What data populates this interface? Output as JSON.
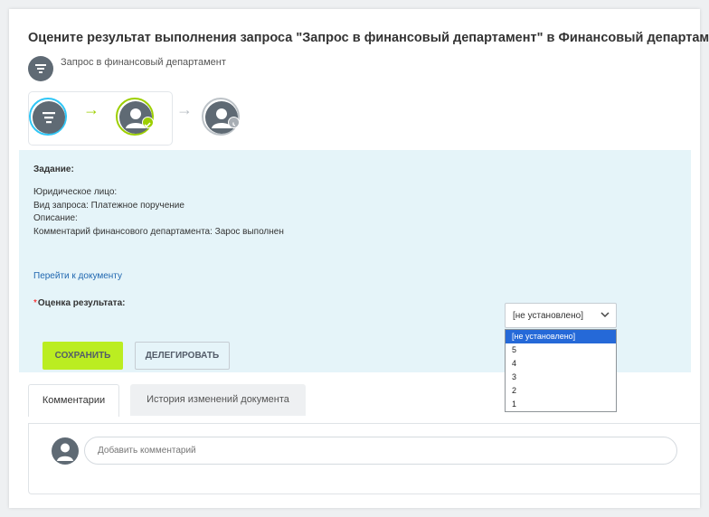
{
  "header": {
    "title": "Оцените результат выполнения запроса \"Запрос в финансовый департамент\" в Финансовый департамент!",
    "subtitle": "Запрос в финансовый департамент"
  },
  "task": {
    "heading": "Задание:",
    "lines": [
      "Юридическое лицо:",
      "Вид запроса: Платежное поручение",
      "Описание:",
      "Комментарий финансового департамента: Зарос выполнен"
    ],
    "doc_link": "Перейти к документу"
  },
  "rating": {
    "required_mark": "*",
    "label": "Оценка результата:",
    "selected": "[не установлено]",
    "options": [
      "[не установлено]",
      "5",
      "4",
      "3",
      "2",
      "1"
    ]
  },
  "buttons": {
    "save": "СОХРАНИТЬ",
    "delegate": "ДЕЛЕГИРОВАТЬ"
  },
  "tabs": [
    {
      "label": "Комментарии"
    },
    {
      "label": "История изменений документа"
    }
  ],
  "comment": {
    "placeholder": "Добавить комментарий"
  },
  "colors": {
    "accent_green": "#bbed21",
    "step_blue": "#2fc6f6",
    "step_green": "#9dcf00",
    "panel_bg": "#e5f4f9",
    "selection_blue": "#2569d8"
  },
  "icons": {
    "route_start": "filter-icon",
    "route_done": "user-check-icon",
    "route_pending": "user-clock-icon"
  }
}
